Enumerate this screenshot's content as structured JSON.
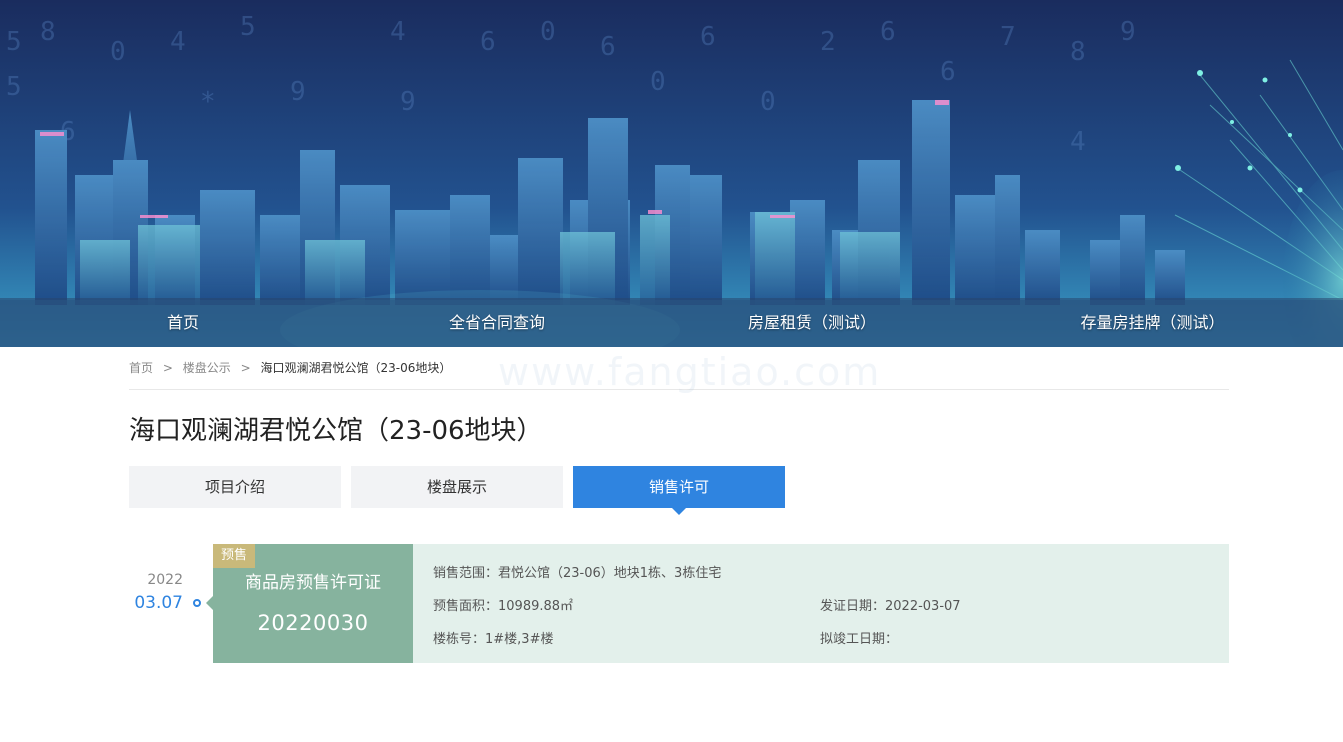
{
  "nav": {
    "items": [
      {
        "label": "首页"
      },
      {
        "label": "全省合同查询"
      },
      {
        "label": "房屋租赁（测试）"
      },
      {
        "label": "存量房挂牌（测试）"
      }
    ]
  },
  "breadcrumb": {
    "home": "首页",
    "section": "楼盘公示",
    "separator": ">",
    "current": "海口观澜湖君悦公馆（23-06地块）"
  },
  "watermark": "www.fangtiao.com",
  "page": {
    "title": "海口观澜湖君悦公馆（23-06地块）"
  },
  "tabs": [
    {
      "label": "项目介绍",
      "active": false
    },
    {
      "label": "楼盘展示",
      "active": false
    },
    {
      "label": "销售许可",
      "active": true
    }
  ],
  "permits": [
    {
      "year": "2022",
      "month_day": "03.07",
      "tag": "预售",
      "type": "商品房预售许可证",
      "number": "20220030",
      "scope": "销售范围：君悦公馆（23-06）地块1栋、3栋住宅",
      "area": "预售面积：10989.88㎡",
      "issue_date": "发证日期：2022-03-07",
      "buildings": "楼栋号：1#楼,3#楼",
      "completion_date": "拟竣工日期："
    }
  ],
  "colors": {
    "accent": "#2f84e0",
    "card_left": "#86b39e",
    "card_right": "#e3f0eb",
    "tag": "#c9b97a",
    "banner": "#1f3f7c"
  }
}
